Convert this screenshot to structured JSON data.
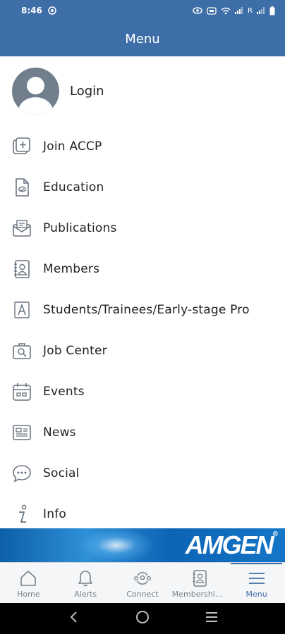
{
  "status_bar": {
    "time": "8:46",
    "carrier_indicator": "R"
  },
  "header": {
    "title": "Menu"
  },
  "login": {
    "label": "Login"
  },
  "menu": {
    "items": [
      {
        "label": "Join ACCP",
        "icon": "join-plus-icon"
      },
      {
        "label": "Education",
        "icon": "education-document-icon"
      },
      {
        "label": "Publications",
        "icon": "publications-envelope-icon"
      },
      {
        "label": "Members",
        "icon": "members-contact-icon"
      },
      {
        "label": "Students/Trainees/Early-stage Pro",
        "icon": "students-icon"
      },
      {
        "label": "Job Center",
        "icon": "job-center-search-icon"
      },
      {
        "label": "Events",
        "icon": "calendar-icon"
      },
      {
        "label": "News",
        "icon": "newspaper-icon"
      },
      {
        "label": "Social",
        "icon": "chat-bubble-icon"
      },
      {
        "label": "Info",
        "icon": "info-icon"
      }
    ]
  },
  "banner": {
    "brand": "AMGEN",
    "mark": "®"
  },
  "tabs": [
    {
      "label": "Home",
      "icon": "home-icon",
      "active": false
    },
    {
      "label": "Alerts",
      "icon": "bell-icon",
      "active": false
    },
    {
      "label": "Connect",
      "icon": "connect-icon",
      "active": false
    },
    {
      "label": "Membership...",
      "icon": "membership-icon",
      "active": false
    },
    {
      "label": "Menu",
      "icon": "hamburger-menu-icon",
      "active": true
    }
  ],
  "colors": {
    "primary": "#3e6ea8",
    "text": "#222222",
    "icon": "#6b7480",
    "tab_inactive": "#7a8088"
  }
}
